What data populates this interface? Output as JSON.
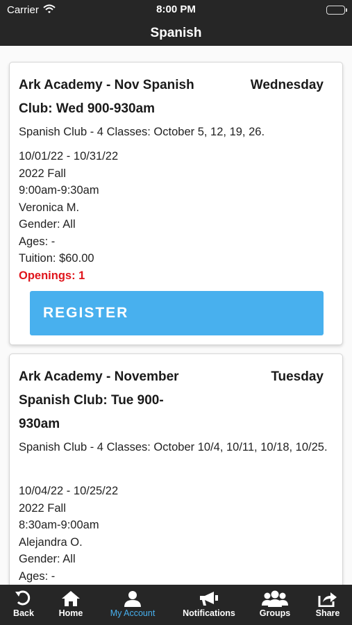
{
  "status_bar": {
    "carrier": "Carrier",
    "time": "8:00 PM"
  },
  "nav": {
    "title": "Spanish"
  },
  "classes": [
    {
      "title": "Ark Academy - Nov Spanish Club: Wed 900-930am",
      "day": "Wednesday",
      "description": "Spanish Club - 4 Classes: October 5, 12, 19, 26.",
      "dates": "10/01/22 - 10/31/22",
      "term": "2022 Fall",
      "time": "9:00am-9:30am",
      "instructor": "Veronica M.",
      "gender": "Gender: All",
      "ages": "Ages: -",
      "tuition": "Tuition: $60.00",
      "openings": "Openings: 1",
      "register_label": "REGISTER"
    },
    {
      "title": "Ark Academy - November Spanish Club: Tue 900-930am",
      "day": "Tuesday",
      "description": "Spanish Club - 4 Classes: October 10/4, 10/11, 10/18, 10/25.",
      "dates": "10/04/22 - 10/25/22",
      "term": "2022 Fall",
      "time": "8:30am-9:00am",
      "instructor": "Alejandra O.",
      "gender": "Gender: All",
      "ages": "Ages: -"
    }
  ],
  "tabs": [
    {
      "label": "Back",
      "icon": "back-icon"
    },
    {
      "label": "Home",
      "icon": "home-icon"
    },
    {
      "label": "My Account",
      "icon": "account-icon",
      "active": true
    },
    {
      "label": "Notifications",
      "icon": "megaphone-icon"
    },
    {
      "label": "Groups",
      "icon": "groups-icon"
    },
    {
      "label": "Share",
      "icon": "share-icon"
    }
  ],
  "colors": {
    "bar_bg": "#262626",
    "accent": "#48b0ee",
    "openings": "#e0141b"
  }
}
